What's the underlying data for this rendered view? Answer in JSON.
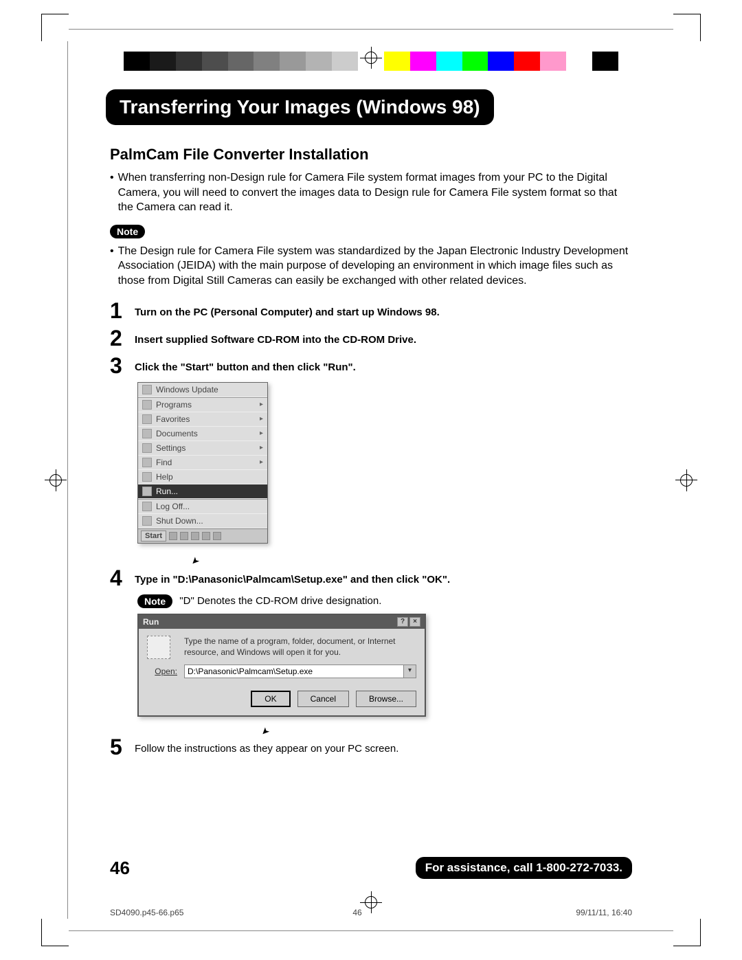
{
  "title": "Transferring Your Images (Windows 98)",
  "section_heading": "PalmCam File Converter Installation",
  "intro_bullet": "When transferring non-Design rule for Camera File system format images from your PC to the Digital Camera, you will need to convert the images data to Design rule for Camera File system format so that the Camera can read it.",
  "note_label": "Note",
  "note_bullet": "The Design rule for Camera File system was standardized by the Japan Electronic Industry Development Association (JEIDA) with the main purpose of developing an environment in which image files such as those from Digital Still Cameras can easily be exchanged with other related devices.",
  "steps": {
    "s1": "Turn on the PC (Personal Computer) and start up Windows 98.",
    "s2": "Insert supplied Software CD-ROM into the CD-ROM Drive.",
    "s3": "Click the \"Start\" button and then click \"Run\".",
    "s4": "Type in \"D:\\Panasonic\\Palmcam\\Setup.exe\" and then click \"OK\".",
    "s4_note": "\"D\" Denotes the CD-ROM drive designation.",
    "s5": "Follow the instructions as they appear on your PC screen."
  },
  "start_menu": {
    "items": [
      "Windows Update",
      "Programs",
      "Favorites",
      "Documents",
      "Settings",
      "Find",
      "Help",
      "Run...",
      "Log Off...",
      "Shut Down..."
    ],
    "selected_index": 7,
    "start_label": "Start"
  },
  "run_dialog": {
    "title": "Run",
    "prompt": "Type the name of a program, folder, document, or Internet resource, and Windows will open it for you.",
    "open_label": "Open:",
    "input_value": "D:\\Panasonic\\Palmcam\\Setup.exe",
    "buttons": {
      "ok": "OK",
      "cancel": "Cancel",
      "browse": "Browse..."
    }
  },
  "page_number": "46",
  "assistance": "For assistance, call 1-800-272-7033.",
  "meta": {
    "file": "SD4090.p45-66.p65",
    "page": "46",
    "timestamp": "99/11/11, 16:40"
  },
  "color_bar": [
    "#000000",
    "#1a1a1a",
    "#333333",
    "#4d4d4d",
    "#666666",
    "#808080",
    "#999999",
    "#b3b3b3",
    "#cccccc",
    "#ffffff",
    "#ffff00",
    "#ff00ff",
    "#00ffff",
    "#00ff00",
    "#0000ff",
    "#ff0000",
    "#ff99cc",
    "#ffffff",
    "#000000"
  ]
}
